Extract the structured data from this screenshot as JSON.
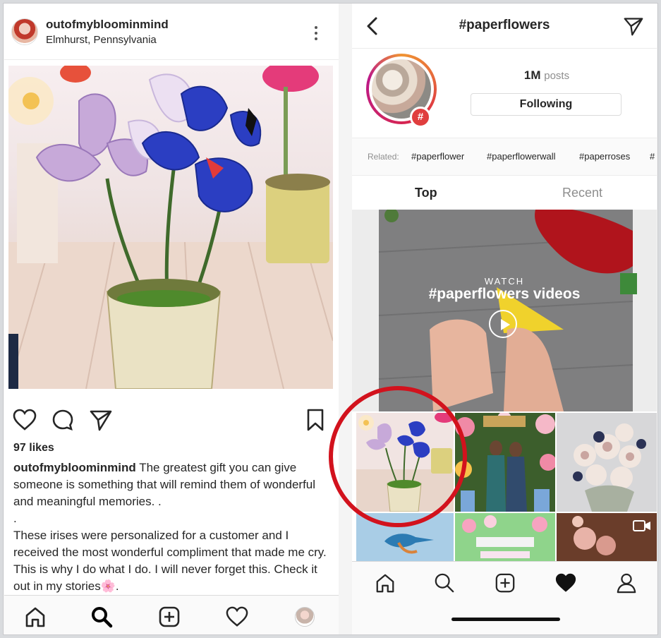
{
  "left": {
    "post": {
      "username": "outofmybloominmind",
      "location": "Elmhurst, Pennsylvania",
      "likes": "97 likes",
      "caption_user": "outofmybloominmind",
      "caption_line1": "The greatest gift you can give someone is something that will remind them of wonderful and meaningful memories. .",
      "caption_dot": ".",
      "caption_line2": "These irises were personalized for a customer and I received the most wonderful compliment that made me cry. This is why I do what I do. I will never forget this. Check it out in my stories🌸."
    },
    "tabbar": [
      "home-icon",
      "search-icon",
      "add-icon",
      "heart-icon",
      "profile-avatar"
    ]
  },
  "right": {
    "header": {
      "title": "#paperflowers"
    },
    "tag": {
      "posts_count": "1M",
      "posts_label": "posts",
      "follow_label": "Following",
      "badge": "#"
    },
    "related": {
      "label": "Related:",
      "tags": [
        "#paperflower",
        "#paperflowerwall",
        "#paperroses",
        "#"
      ]
    },
    "tabs": {
      "top": "Top",
      "recent": "Recent"
    },
    "video": {
      "watch": "WATCH",
      "title": "#paperflowers videos"
    },
    "tabbar": [
      "home-icon",
      "search-icon",
      "add-icon",
      "heart-icon-filled",
      "profile-icon"
    ]
  },
  "colors": {
    "highlight": "#d2121d",
    "text": "#262626",
    "muted": "#8e8e8e"
  }
}
